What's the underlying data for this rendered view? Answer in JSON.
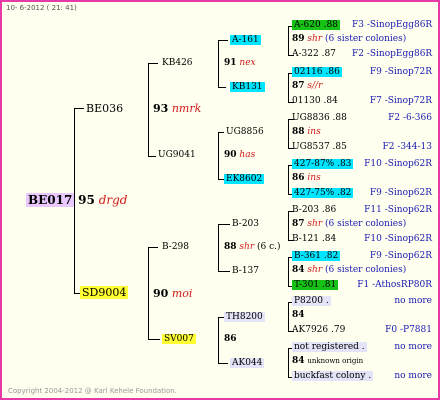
{
  "header": {
    "timestamp": "10-  6-2012 ( 21: 41)"
  },
  "footer": {
    "copyright": "Copyright 2004-2012 @ Karl Kehele Foundation."
  },
  "colors": {
    "border": "#e63aa6",
    "cyan": "#00e5ff",
    "green": "#17c217",
    "yellow": "#ffff33",
    "pink": "#e8c8ff",
    "red": "#d31919",
    "blue": "#1a1ab0"
  },
  "root": {
    "name": "BE017",
    "number": "95",
    "tag": "drgd"
  },
  "gen1": {
    "top": {
      "name": "BE036",
      "number": "93",
      "tag": "nmrk"
    },
    "bottom": {
      "name": "SD9004",
      "number": "90",
      "tag": "moi"
    }
  },
  "gen2": {
    "a": {
      "name": "KB426",
      "number": "91",
      "tag": "nex"
    },
    "b": {
      "name": "UG9041",
      "number": "90",
      "tag": "has"
    },
    "c": {
      "name": "B-298",
      "number": "88",
      "tag": "shr",
      "extra": "(6 c.)"
    },
    "d": {
      "name": "SV007",
      "number": "86"
    }
  },
  "gen3": [
    {
      "name": "A-161"
    },
    {
      "name": "KB131"
    },
    {
      "name": "UG8856"
    },
    {
      "name": "EK8602"
    },
    {
      "name": "B-203"
    },
    {
      "name": "B-137"
    },
    {
      "name": "TH8200"
    },
    {
      "name": "AK044"
    }
  ],
  "gen4": [
    {
      "l1": "A-620 .88",
      "l1code": "F3 -SinopEgg86R",
      "num": "89",
      "tag": "shr",
      "note": "(6 sister colonies)",
      "l3": "A-322 .87",
      "l3code": "F2 -SinopEgg86R"
    },
    {
      "l1": "02116 .86",
      "l1code": "F9 -Sinop72R",
      "num": "87",
      "tag": "s//r",
      "note": "",
      "l3": "01130 .84",
      "l3code": "F7 -Sinop72R"
    },
    {
      "l1": "UG8836 .88",
      "l1code": "F2 -6-366",
      "num": "88",
      "tag": "ins",
      "note": "",
      "l3": "UG8537 .85",
      "l3code": "F2 -344-13"
    },
    {
      "l1": "427-87% .83",
      "l1code": "F10 -Sinop62R",
      "num": "86",
      "tag": "ins",
      "note": "",
      "l3": "427-75% .82",
      "l3code": "F9 -Sinop62R"
    },
    {
      "l1": "B-203 .86",
      "l1code": "F11 -Sinop62R",
      "num": "87",
      "tag": "shr",
      "note": "(6 sister colonies)",
      "l3": "B-121 .84",
      "l3code": "F10 -Sinop62R"
    },
    {
      "l1": "B-361 .82",
      "l1code": "F9 -Sinop62R",
      "num": "84",
      "tag": "shr",
      "note": "(6 sister colonies)",
      "l3": "T-301 .81",
      "l3code": "F1 -AthosRP80R"
    },
    {
      "l1": "P8200 .",
      "l1code": "no more",
      "num": "84",
      "tag": "",
      "note": "",
      "l3": "AK7926 .79",
      "l3code": "F0 -P7881"
    },
    {
      "l1": "not registered .",
      "l1code": "no more",
      "num": "84",
      "tag": "unknown origin",
      "note": "",
      "l3": "buckfast colony .",
      "l3code": "no more"
    }
  ]
}
